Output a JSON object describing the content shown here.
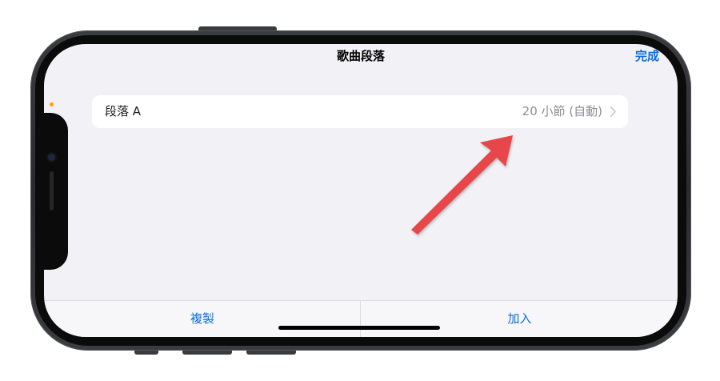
{
  "nav": {
    "title": "歌曲段落",
    "done_label": "完成"
  },
  "list": {
    "rows": [
      {
        "label": "段落 A",
        "detail": "20 小節 (自動)"
      }
    ]
  },
  "toolbar": {
    "copy_label": "複製",
    "add_label": "加入"
  },
  "colors": {
    "accent": "#0a6fe0",
    "annotation_arrow": "#e8464a",
    "background": "#f2f1f6"
  },
  "icons": {
    "row_disclosure": "chevron-right-icon",
    "annotation": "red-arrow-icon"
  }
}
